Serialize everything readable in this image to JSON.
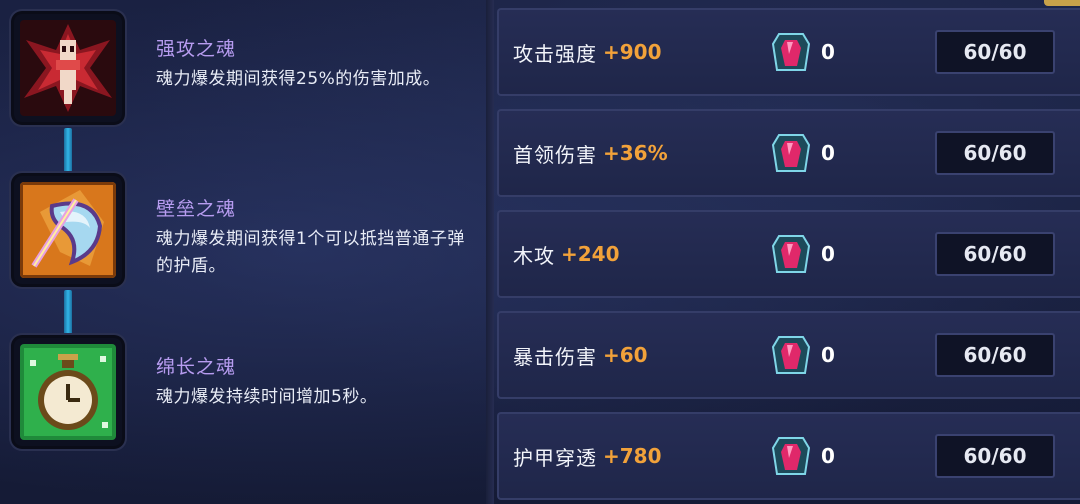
{
  "skills": [
    {
      "name": "强攻之魂",
      "description": "魂力爆发期间获得25%的伤害加成。",
      "icon": "red-demon-icon"
    },
    {
      "name": "壁垒之魂",
      "description": "魂力爆发期间获得1个可以抵挡普通子弹的护盾。",
      "icon": "shield-icon"
    },
    {
      "name": "绵长之魂",
      "description": "魂力爆发持续时间增加5秒。",
      "icon": "stopwatch-icon"
    }
  ],
  "stats": [
    {
      "label": "攻击强度",
      "bonus": "+900",
      "gem_count": "0",
      "level": "60/60"
    },
    {
      "label": "首领伤害",
      "bonus": "+36%",
      "gem_count": "0",
      "level": "60/60"
    },
    {
      "label": "木攻",
      "bonus": "+240",
      "gem_count": "0",
      "level": "60/60"
    },
    {
      "label": "暴击伤害",
      "bonus": "+60",
      "gem_count": "0",
      "level": "60/60"
    },
    {
      "label": "护甲穿透",
      "bonus": "+780",
      "gem_count": "0",
      "level": "60/60"
    }
  ],
  "colors": {
    "skill_name": "#b79cf0",
    "bonus": "#f2a23a",
    "connector": "#31b6e8",
    "background": "#141a33"
  }
}
